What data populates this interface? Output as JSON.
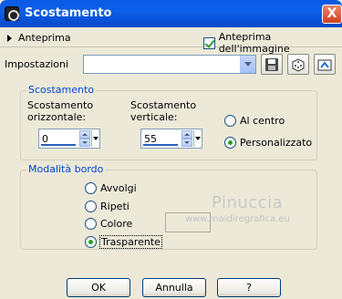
{
  "window": {
    "title": "Scostamento",
    "close_label": "X"
  },
  "preview": {
    "toggle_label": "Anteprima",
    "image_preview_label": "Anteprima dell'immagine",
    "image_preview_checked": true
  },
  "settings": {
    "label": "Impostazioni",
    "value": ""
  },
  "offset_group": {
    "label": "Scostamento",
    "horizontal_label_1": "Scostamento",
    "horizontal_label_2": "orizzontale:",
    "horizontal_value": "0",
    "vertical_label_1": "Scostamento",
    "vertical_label_2": "verticale:",
    "vertical_value": "55",
    "center_label": "Al centro",
    "custom_label": "Personalizzato",
    "selected": "custom"
  },
  "edge_group": {
    "label": "Modalità bordo",
    "options": [
      "Avvolgi",
      "Ripeti",
      "Colore",
      "Trasparente"
    ],
    "selected": "Trasparente"
  },
  "watermark": {
    "name": "Pinuccia",
    "url": "www.maidiregrafica.eu"
  },
  "buttons": {
    "ok": "OK",
    "cancel": "Annulla",
    "help": "?"
  },
  "colors": {
    "titlebar": "#0a5ae6",
    "group_label": "#0046d5",
    "background": "#ece9d8"
  }
}
